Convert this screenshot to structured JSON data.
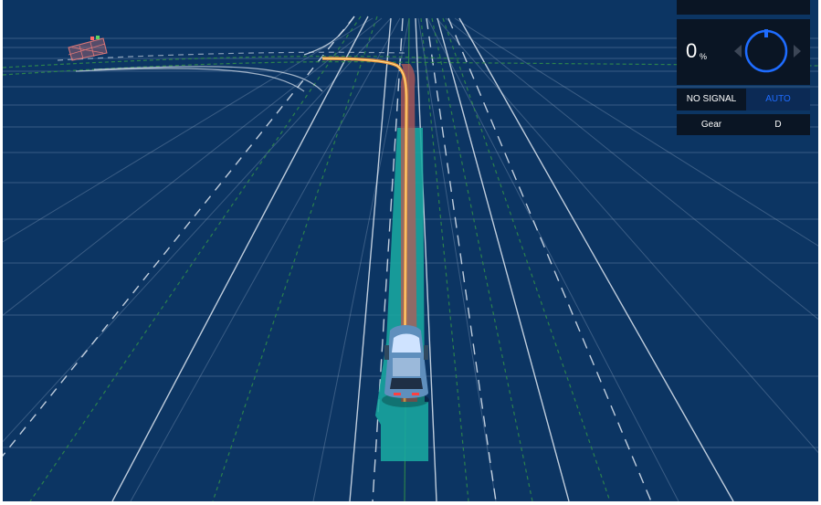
{
  "status_panel": {
    "throttle_value": "0",
    "throttle_unit": "%",
    "signal_label": "NO SIGNAL",
    "mode_label": "AUTO",
    "gear_label": "Gear",
    "gear_value": "D"
  },
  "colors": {
    "background": "#0c3563",
    "grid_line": "#8fa6c2",
    "lane_line": "#dfe8f2",
    "lane_boundary_green": "#2f8a4a",
    "planning_trajectory": "#e8903a",
    "planning_band": "#b85a55",
    "drivable_corridor": "#19a8a0",
    "obstacle": "#e07878",
    "mode_active": "#1e6cff",
    "steering_dial": "#1e6cff"
  },
  "icons": {
    "steering_wheel": "steering-dial-icon",
    "steer_left": "chevron-left-icon",
    "steer_right": "chevron-right-icon",
    "ego_vehicle": "car-icon"
  }
}
